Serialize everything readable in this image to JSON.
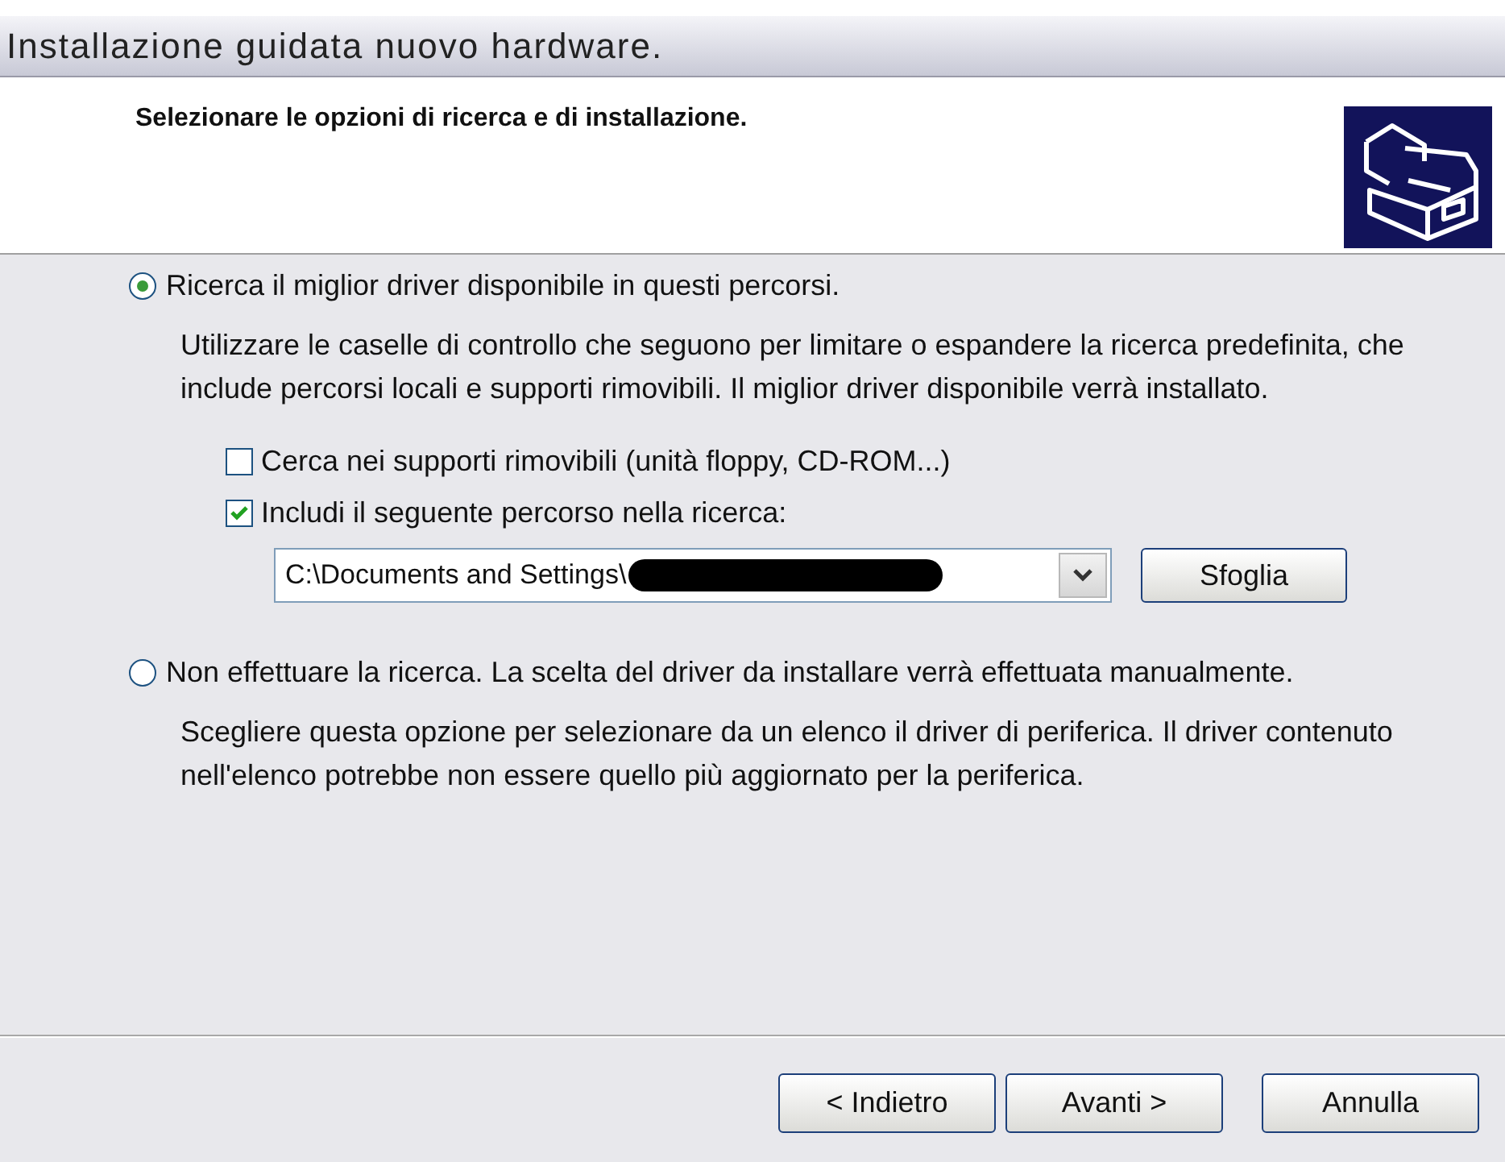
{
  "window": {
    "title": "Installazione guidata nuovo hardware."
  },
  "header": {
    "title": "Selezionare le opzioni di ricerca e di installazione."
  },
  "options": [
    {
      "label": "Ricerca il miglior driver disponibile in questi percorsi.",
      "selected": true,
      "description": "Utilizzare le caselle di controllo che seguono per limitare o espandere la ricerca predefinita, che include percorsi locali e supporti rimovibili. Il miglior driver disponibile verrà installato.",
      "checkboxes": [
        {
          "label": "Cerca nei supporti rimovibili (unità floppy, CD-ROM...)",
          "checked": false
        },
        {
          "label": "Includi il seguente percorso nella ricerca:",
          "checked": true
        }
      ],
      "path": {
        "value": "C:\\Documents and Settings\\",
        "redacted": true
      },
      "browse": "Sfoglia"
    },
    {
      "label": "Non effettuare la ricerca. La scelta del driver da installare verrà effettuata manualmente.",
      "selected": false,
      "description": "Scegliere questa opzione per selezionare da un elenco il driver di periferica. Il driver contenuto nell'elenco potrebbe non essere quello più aggiornato per la periferica."
    }
  ],
  "buttons": [
    {
      "label": "< Indietro"
    },
    {
      "label": "Avanti >"
    },
    {
      "label": "Annulla"
    }
  ]
}
